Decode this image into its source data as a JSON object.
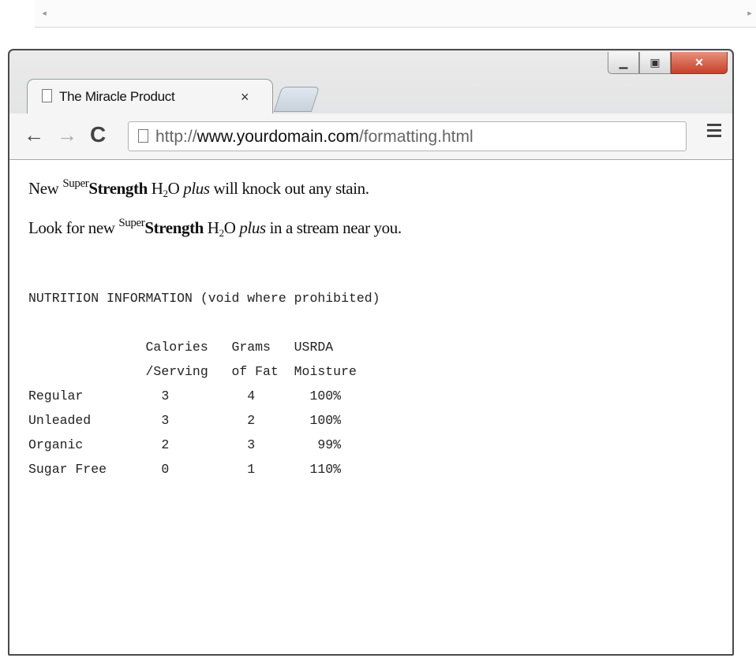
{
  "tab": {
    "title": "The Miracle Product",
    "close_label": "×"
  },
  "toolbar": {
    "url_scheme": "http://",
    "url_host": "www.yourdomain.com",
    "url_path": "/formatting.html"
  },
  "content": {
    "line1": {
      "pre": "New ",
      "sup": "Super",
      "bold": "Strength",
      "h": " H",
      "sub": "2",
      "o": "O ",
      "italic": "plus",
      "post": " will knock out any stain."
    },
    "line2": {
      "pre": "Look for new ",
      "sup": "Super",
      "bold": "Strength",
      "h": " H",
      "sub": "2",
      "o": "O ",
      "italic": "plus",
      "post": " in a stream near you."
    },
    "nutrition_pre": "NUTRITION INFORMATION (void where prohibited)\n\n               Calories   Grams   USRDA\n               /Serving   of Fat  Moisture\nRegular          3          4       100%\nUnleaded         3          2       100%\nOrganic          2          3        99%\nSugar Free       0          1       110%"
  }
}
